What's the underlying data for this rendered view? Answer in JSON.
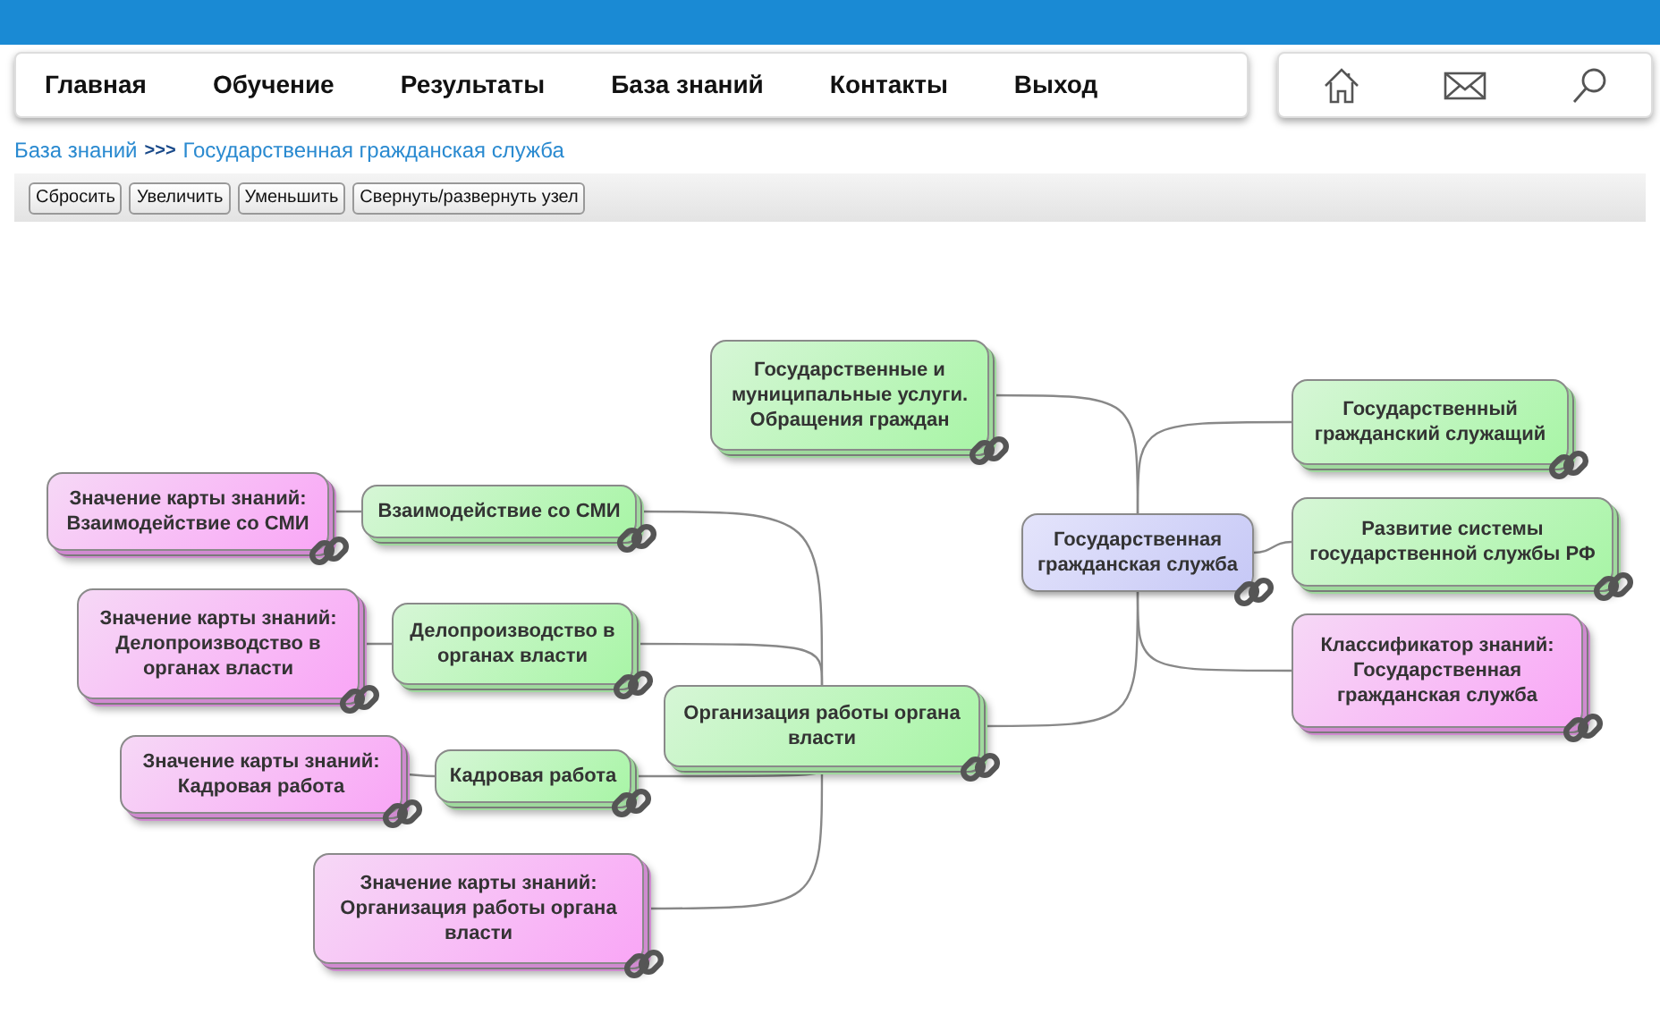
{
  "nav": {
    "items": [
      "Главная",
      "Обучение",
      "Результаты",
      "База знаний",
      "Контакты",
      "Выход"
    ]
  },
  "breadcrumb": [
    {
      "label": "База знаний"
    },
    {
      "label": "Государственная гражданская служба"
    }
  ],
  "breadcrumb_separator": ">>>",
  "toolbar": {
    "buttons": [
      "Сбросить",
      "Увеличить",
      "Уменьшить",
      "Свернуть/развернуть узел"
    ]
  },
  "mindmap": {
    "root": {
      "label": "Государственная гражданская служба",
      "kind": "root",
      "children": [
        {
          "label": "Государственные и муниципальные услуги. Обращения граждан",
          "kind": "topic"
        },
        {
          "label": "Организация работы органа власти",
          "kind": "topic",
          "children": [
            {
              "label": "Взаимодействие со СМИ",
              "kind": "topic",
              "children": [
                {
                  "label": "Значение карты знаний: Взаимодействие со СМИ",
                  "kind": "meaning"
                }
              ]
            },
            {
              "label": "Делопроизводство в органах власти",
              "kind": "topic",
              "children": [
                {
                  "label": "Значение карты знаний: Делопроизводство в органах власти",
                  "kind": "meaning"
                }
              ]
            },
            {
              "label": "Кадровая работа",
              "kind": "topic",
              "children": [
                {
                  "label": "Значение карты знаний: Кадровая работа",
                  "kind": "meaning"
                }
              ]
            },
            {
              "label": "Значение карты знаний: Организация работы органа власти",
              "kind": "meaning"
            }
          ]
        },
        {
          "label": "Государственный гражданский служащий",
          "kind": "topic"
        },
        {
          "label": "Развитие системы государственной службы РФ",
          "kind": "topic"
        },
        {
          "label": "Классификатор знаний: Государственная гражданская служба",
          "kind": "meaning"
        }
      ]
    }
  }
}
